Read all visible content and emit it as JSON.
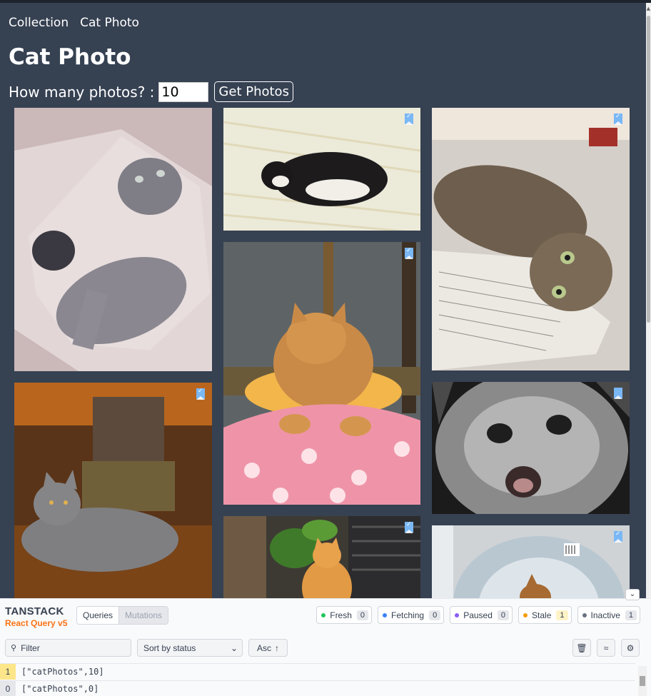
{
  "nav": {
    "items": [
      "Collection",
      "Cat Photo"
    ]
  },
  "page": {
    "title": "Cat Photo"
  },
  "form": {
    "label": "How many photos? :",
    "count_value": "10",
    "button_label": "Get Photos"
  },
  "photos": [
    {
      "name": "cat-in-box",
      "bookmarked": false
    },
    {
      "name": "cat-sleeping-bed",
      "bookmarked": true
    },
    {
      "name": "cat-on-book",
      "bookmarked": true
    },
    {
      "name": "cat-on-pink-blanket",
      "bookmarked": true
    },
    {
      "name": "grey-cat-on-chair",
      "bookmarked": true
    },
    {
      "name": "kitten-screaming",
      "bookmarked": false
    },
    {
      "name": "orange-cat-window",
      "bookmarked": true
    },
    {
      "name": "cat-in-cone",
      "bookmarked": true
    }
  ],
  "devtools": {
    "brand_line1": "TANSTACK",
    "brand_line2": "React Query v5",
    "tabs": [
      "Queries",
      "Mutations"
    ],
    "badges": [
      {
        "label": "Fresh",
        "count": "0",
        "color": "#22c55e"
      },
      {
        "label": "Fetching",
        "count": "0",
        "color": "#3b82f6"
      },
      {
        "label": "Paused",
        "count": "0",
        "color": "#8b5cf6"
      },
      {
        "label": "Stale",
        "count": "1",
        "color": "#f59e0b"
      },
      {
        "label": "Inactive",
        "count": "1",
        "color": "#6b7280"
      }
    ],
    "filter_placeholder": "Filter",
    "sort_label": "Sort by status",
    "order_label": "Asc",
    "queries": [
      {
        "count": "1",
        "key": "[\"catPhotos\",10]",
        "status_color": "#fde68a"
      },
      {
        "count": "0",
        "key": "[\"catPhotos\",0]",
        "status_color": "#e5e7eb"
      }
    ]
  }
}
